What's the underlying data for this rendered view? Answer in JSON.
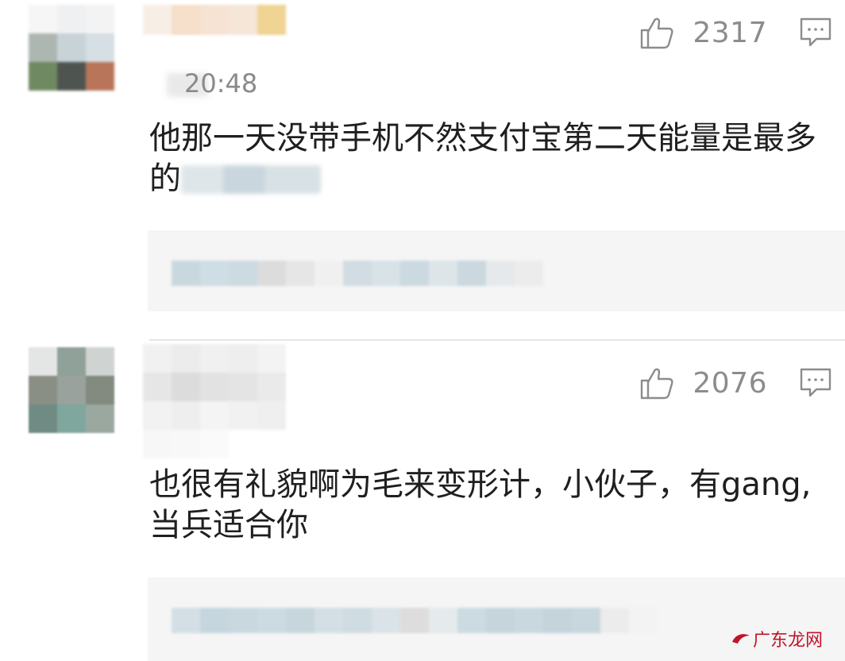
{
  "comments": [
    {
      "id": "c1",
      "time": "20:48",
      "likes": "2317",
      "text": "他那一天没带手机不然支付宝第二天能量是最多的"
    },
    {
      "id": "c2",
      "likes": "2076",
      "text": "也很有礼貌啊为毛来变形计，小伙子，有gang,当兵适合你"
    }
  ],
  "watermark": "广东龙网",
  "icons": {
    "like": "thumbs-up-icon",
    "reply": "comment-bubble-icon"
  },
  "colors": {
    "text": "#1f1f1f",
    "meta": "#8c8c8c",
    "reply_bg": "#f5f5f5",
    "watermark": "#c0142b"
  }
}
